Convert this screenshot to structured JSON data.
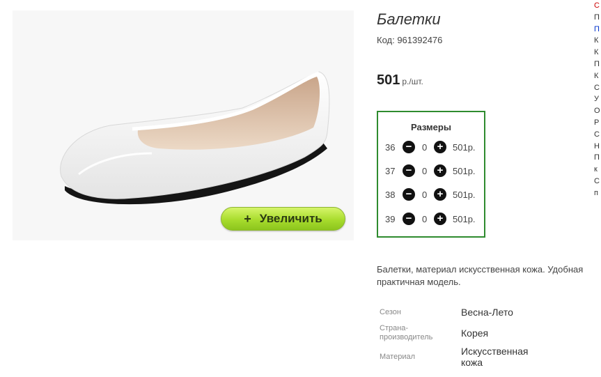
{
  "product": {
    "title": "Балетки",
    "code": "Код: 961392476",
    "price": "501",
    "price_unit": "р./шт."
  },
  "image": {
    "zoom_label": "Увеличить",
    "zoom_plus": "+"
  },
  "sizes": {
    "title": "Размеры",
    "rows": [
      {
        "size": "36",
        "qty": "0",
        "price": "501р."
      },
      {
        "size": "37",
        "qty": "0",
        "price": "501р."
      },
      {
        "size": "38",
        "qty": "0",
        "price": "501р."
      },
      {
        "size": "39",
        "qty": "0",
        "price": "501р."
      }
    ]
  },
  "description": {
    "line1": "Балетки, материал искусственная кожа. Удобная",
    "line2": "практичная модель."
  },
  "attributes": [
    {
      "label": "Сезон",
      "value": "Весна-Лето"
    },
    {
      "label": "Страна-\nпроизводитель",
      "value": "Корея"
    },
    {
      "label": "Материал",
      "value": "Искусственная\nкожа"
    }
  ],
  "sidebar_letters": [
    "С",
    "П",
    "П",
    "К",
    "К",
    "П",
    "К",
    "С",
    "У",
    "О",
    "Р",
    "С",
    "Н",
    "П",
    "к",
    "С",
    "п"
  ],
  "colors": {
    "accent_green": "#2e8b2e",
    "button_green": "#a8dc2d",
    "sidebar_red": "#cc0000",
    "sidebar_blue": "#0033cc"
  }
}
